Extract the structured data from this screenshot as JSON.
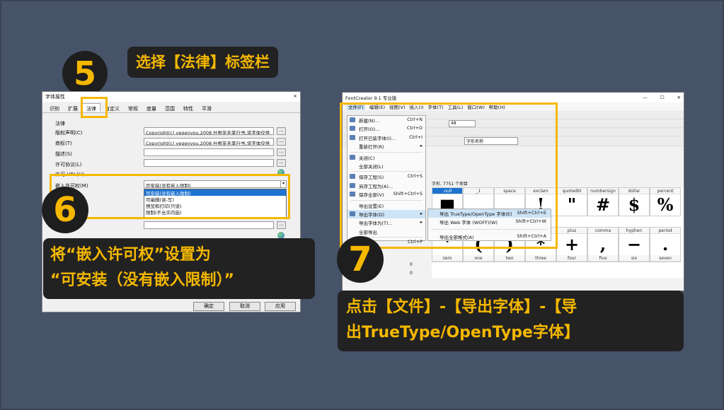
{
  "steps": {
    "s5": "5",
    "s6": "6",
    "s7": "7"
  },
  "banners": {
    "b5": "选择【法律】标签栏",
    "b6_line1": "将“嵌入许可权”设置为",
    "b6_line2": "“可安装（没有嵌入限制）”",
    "b7_line1": "点击【文件】-【导出字体】-【导",
    "b7_line2": "出TrueType/OpenType字体】"
  },
  "dialog": {
    "title": "字体属性",
    "close": "×",
    "tabs": [
      "识别",
      "扩展",
      "法律",
      "自定义",
      "常规",
      "度量",
      "范围",
      "特性",
      "平滑"
    ],
    "section": "法律",
    "fields": [
      {
        "label": "版权声明(C)",
        "value": "Copyright(c) yegenyou.2008   叶根友毛笔行书,该字体仅供"
      },
      {
        "label": "商标(T)",
        "value": "Copyright(c) yegenyou.2008   叶根友毛笔行书,该字体仅供"
      },
      {
        "label": "描述(S)",
        "value": ""
      },
      {
        "label": "许可协议(L)",
        "value": ""
      },
      {
        "label": "许可 URL(U)",
        "value": ""
      }
    ],
    "embed_label": "嵌入许可权(M)",
    "embed_value": "可安装(没有嵌入限制)",
    "embed_options": [
      "可安装(没有嵌入限制)",
      "可编辑(读-写)",
      "预览和打印(只读)",
      "限制(不允许内嵌)"
    ],
    "ok": "确定",
    "cancel": "取消",
    "apply": "应用"
  },
  "fc": {
    "title": "FontCreator 9.1 专业版",
    "win": [
      "—",
      "☐",
      "✕"
    ],
    "menus": [
      "文件(F)",
      "编辑(E)",
      "视图(V)",
      "插入(I)",
      "字体(T)",
      "工具(L)",
      "窗口(W)",
      "帮助(H)"
    ],
    "file_menu": [
      {
        "label": "新建(N)...",
        "key": "Ctrl+N"
      },
      {
        "label": "打开(O)...",
        "key": "Ctrl+O"
      },
      {
        "label": "打开已装字体(I)...",
        "key": "Ctrl+I"
      },
      {
        "label": "重新打开(R)",
        "key": "▸"
      },
      {
        "label": "关闭(C)",
        "key": ""
      },
      {
        "label": "全部关闭(L)",
        "key": ""
      },
      {
        "label": "保存工程(S)",
        "key": "Ctrl+S"
      },
      {
        "label": "另存工程为(A)...",
        "key": ""
      },
      {
        "label": "保存全部(V)",
        "key": "Shift+Ctrl+S"
      },
      {
        "label": "导出设置(E)",
        "key": ""
      },
      {
        "label": "导出字体(D)",
        "key": "▸"
      },
      {
        "label": "导出字体为(T)...",
        "key": "▸"
      },
      {
        "label": "全部导出",
        "key": ""
      },
      {
        "label": "打印(P)...",
        "key": "Ctrl+P"
      }
    ],
    "export_sub": [
      {
        "label": "导出 TrueType/OpenType 字体(E)",
        "key": "Shift+Ctrl+E"
      },
      {
        "label": "导出 Web 字体 (WOFF)(W)",
        "key": "Shift+Ctrl+W"
      },
      {
        "label": "导出全部格式(A)",
        "key": "Shift+Ctrl+A"
      }
    ],
    "zoom": "48",
    "glyph_name_label": "字形名称",
    "count": "字形, 7751 个项目",
    "row1": [
      [
        ".null",
        "■"
      ],
      [
        "_1",
        ""
      ],
      [
        "space",
        ""
      ],
      [
        "exclam",
        "!"
      ],
      [
        "quotedbl",
        "\""
      ],
      [
        "numbersign",
        "#"
      ],
      [
        "dollar",
        "$"
      ],
      [
        "percent",
        "%"
      ]
    ],
    "row2": [
      [
        "",
        "'"
      ],
      [
        "",
        "("
      ],
      [
        "",
        ")"
      ],
      [
        "",
        "*"
      ],
      [
        "plus",
        "+"
      ],
      [
        "comma",
        ","
      ],
      [
        "hyphen",
        "−"
      ],
      [
        "period",
        "."
      ]
    ],
    "row2_names": [
      "zero",
      "one",
      "two",
      "three",
      "four",
      "five",
      "six",
      "seven"
    ],
    "left_nums": [
      "0",
      "0"
    ]
  }
}
